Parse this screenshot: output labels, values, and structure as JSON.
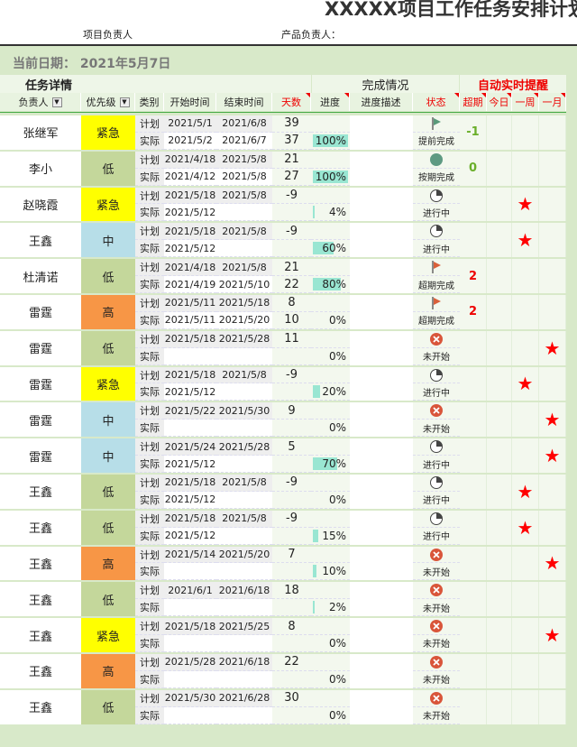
{
  "title": "XXXXX项目工作任务安排计划—",
  "project_owner_label": "项目负责人",
  "product_owner_label": "产品负责人：",
  "current_date": "当前日期：  2021年5月7日",
  "sections": {
    "task": "任务详情",
    "completion": "完成情况",
    "alert": "自动实时提醒"
  },
  "headers": {
    "owner": "负责人",
    "priority": "优先级",
    "type": "类别",
    "start": "开始时间",
    "end": "结束时间",
    "days": "天数",
    "progress": "进度",
    "desc": "进度描述",
    "status": "状态",
    "overdue": "超期",
    "today": "今日",
    "week": "一周",
    "month": "一月"
  },
  "type_labels": {
    "plan": "计划",
    "actual": "实际"
  },
  "colors": {
    "紧急": "#ffff00",
    "低": "#c4d79b",
    "中": "#b7dee8",
    "高": "#f79646"
  },
  "tasks": [
    {
      "owner": "张继军",
      "priority": "紧急",
      "plan": [
        "2021/5/1",
        "2021/6/8",
        "39"
      ],
      "actual": [
        "2021/5/2",
        "2021/6/7",
        "37"
      ],
      "progress": 100,
      "progress_text": "100%",
      "icon": "green-flag",
      "status": "提前完成",
      "overdue": "-1",
      "alert": ""
    },
    {
      "owner": "李小",
      "priority": "低",
      "plan": [
        "2021/4/18",
        "2021/5/8",
        "21"
      ],
      "actual": [
        "2021/4/12",
        "2021/5/8",
        "27"
      ],
      "progress": 100,
      "progress_text": "100%",
      "icon": "circle",
      "status": "按期完成",
      "overdue": "0",
      "alert": ""
    },
    {
      "owner": "赵晓霞",
      "priority": "紧急",
      "plan": [
        "2021/5/18",
        "2021/5/8",
        "-9"
      ],
      "actual": [
        "2021/5/12",
        "",
        ""
      ],
      "progress": 4,
      "progress_text": "4%",
      "icon": "pie",
      "status": "进行中",
      "overdue": "",
      "alert": "week"
    },
    {
      "owner": "王鑫",
      "priority": "中",
      "plan": [
        "2021/5/18",
        "2021/5/8",
        "-9"
      ],
      "actual": [
        "2021/5/12",
        "",
        ""
      ],
      "progress": 60,
      "progress_text": "60%",
      "icon": "pie",
      "status": "进行中",
      "overdue": "",
      "alert": "week"
    },
    {
      "owner": "杜清诺",
      "priority": "低",
      "plan": [
        "2021/4/18",
        "2021/5/8",
        "21"
      ],
      "actual": [
        "2021/4/19",
        "2021/5/10",
        "22"
      ],
      "progress": 80,
      "progress_text": "80%",
      "icon": "red-flag",
      "status": "超期完成",
      "overdue": "2",
      "alert": ""
    },
    {
      "owner": "雷霆",
      "priority": "高",
      "plan": [
        "2021/5/11",
        "2021/5/18",
        "8"
      ],
      "actual": [
        "2021/5/11",
        "2021/5/20",
        "10"
      ],
      "progress": 0,
      "progress_text": "0%",
      "icon": "red-flag",
      "status": "超期完成",
      "overdue": "2",
      "alert": ""
    },
    {
      "owner": "雷霆",
      "priority": "低",
      "plan": [
        "2021/5/18",
        "2021/5/28",
        "11"
      ],
      "actual": [
        "",
        "",
        ""
      ],
      "progress": 0,
      "progress_text": "0%",
      "icon": "x",
      "status": "未开始",
      "overdue": "",
      "alert": "month"
    },
    {
      "owner": "雷霆",
      "priority": "紧急",
      "plan": [
        "2021/5/18",
        "2021/5/8",
        "-9"
      ],
      "actual": [
        "2021/5/12",
        "",
        ""
      ],
      "progress": 20,
      "progress_text": "20%",
      "icon": "pie",
      "status": "进行中",
      "overdue": "",
      "alert": "week"
    },
    {
      "owner": "雷霆",
      "priority": "中",
      "plan": [
        "2021/5/22",
        "2021/5/30",
        "9"
      ],
      "actual": [
        "",
        "",
        ""
      ],
      "progress": 0,
      "progress_text": "0%",
      "icon": "x",
      "status": "未开始",
      "overdue": "",
      "alert": "month"
    },
    {
      "owner": "雷霆",
      "priority": "中",
      "plan": [
        "2021/5/24",
        "2021/5/28",
        "5"
      ],
      "actual": [
        "2021/5/12",
        "",
        ""
      ],
      "progress": 70,
      "progress_text": "70%",
      "icon": "pie",
      "status": "进行中",
      "overdue": "",
      "alert": "month"
    },
    {
      "owner": "王鑫",
      "priority": "低",
      "plan": [
        "2021/5/18",
        "2021/5/8",
        "-9"
      ],
      "actual": [
        "2021/5/12",
        "",
        ""
      ],
      "progress": 0,
      "progress_text": "0%",
      "icon": "pie",
      "status": "进行中",
      "overdue": "",
      "alert": "week"
    },
    {
      "owner": "王鑫",
      "priority": "低",
      "plan": [
        "2021/5/18",
        "2021/5/8",
        "-9"
      ],
      "actual": [
        "2021/5/12",
        "",
        ""
      ],
      "progress": 15,
      "progress_text": "15%",
      "icon": "pie",
      "status": "进行中",
      "overdue": "",
      "alert": "week"
    },
    {
      "owner": "王鑫",
      "priority": "高",
      "plan": [
        "2021/5/14",
        "2021/5/20",
        "7"
      ],
      "actual": [
        "",
        "",
        ""
      ],
      "progress": 10,
      "progress_text": "10%",
      "icon": "x",
      "status": "未开始",
      "overdue": "",
      "alert": "month"
    },
    {
      "owner": "王鑫",
      "priority": "低",
      "plan": [
        "2021/6/1",
        "2021/6/18",
        "18"
      ],
      "actual": [
        "",
        "",
        ""
      ],
      "progress": 2,
      "progress_text": "2%",
      "icon": "x",
      "status": "未开始",
      "overdue": "",
      "alert": ""
    },
    {
      "owner": "王鑫",
      "priority": "紧急",
      "plan": [
        "2021/5/18",
        "2021/5/25",
        "8"
      ],
      "actual": [
        "",
        "",
        ""
      ],
      "progress": 0,
      "progress_text": "0%",
      "icon": "x",
      "status": "未开始",
      "overdue": "",
      "alert": "month"
    },
    {
      "owner": "王鑫",
      "priority": "高",
      "plan": [
        "2021/5/28",
        "2021/6/18",
        "22"
      ],
      "actual": [
        "",
        "",
        ""
      ],
      "progress": 0,
      "progress_text": "0%",
      "icon": "x",
      "status": "未开始",
      "overdue": "",
      "alert": ""
    },
    {
      "owner": "王鑫",
      "priority": "低",
      "plan": [
        "2021/5/30",
        "2021/6/28",
        "30"
      ],
      "actual": [
        "",
        "",
        ""
      ],
      "progress": 0,
      "progress_text": "0%",
      "icon": "x",
      "status": "未开始",
      "overdue": "",
      "alert": ""
    }
  ]
}
